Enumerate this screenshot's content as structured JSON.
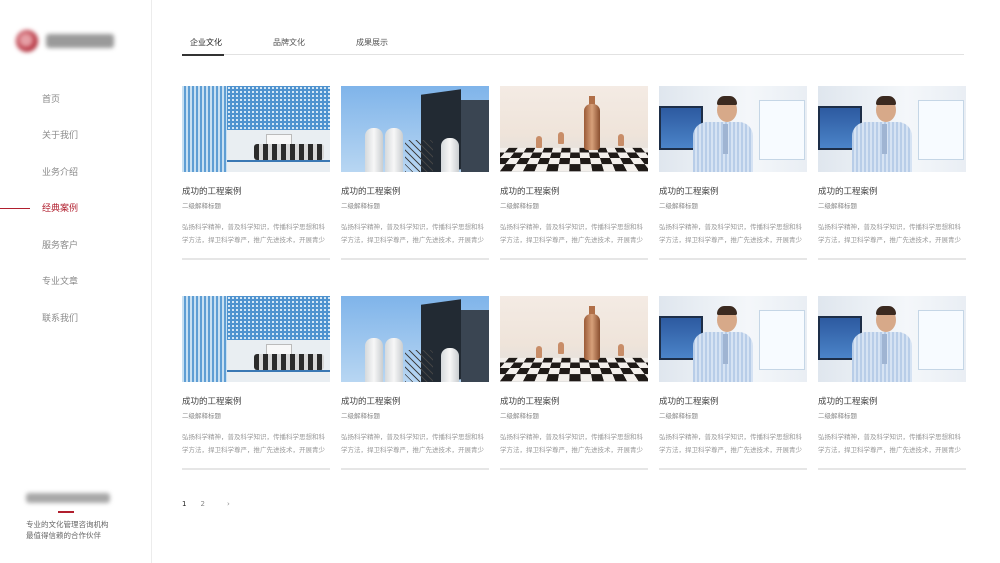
{
  "sidebar": {
    "nav": [
      "首页",
      "关于我们",
      "业务介绍",
      "经典案例",
      "服务客户",
      "专业文章",
      "联系我们"
    ],
    "active_index": 3,
    "footer": {
      "line1": "专业的文化管理咨询机构",
      "line2": "最值得信赖的合作伙伴"
    }
  },
  "tabs": [
    "企业文化",
    "品牌文化",
    "成果展示"
  ],
  "active_tab": 0,
  "cards": [
    {
      "title": "成功的工程案例",
      "subtitle": "二级解释标题",
      "desc": "弘扬科学精神，普及科学知识，传播科学思想和科学方法，捍卫科学尊严，推广先进技术，开展青少"
    },
    {
      "title": "成功的工程案例",
      "subtitle": "二级解释标题",
      "desc": "弘扬科学精神，普及科学知识，传播科学思想和科学方法，捍卫科学尊严，推广先进技术，开展青少"
    },
    {
      "title": "成功的工程案例",
      "subtitle": "二级解释标题",
      "desc": "弘扬科学精神，普及科学知识，传播科学思想和科学方法，捍卫科学尊严，推广先进技术，开展青少"
    },
    {
      "title": "成功的工程案例",
      "subtitle": "二级解释标题",
      "desc": "弘扬科学精神，普及科学知识，传播科学思想和科学方法，捍卫科学尊严，推广先进技术，开展青少"
    },
    {
      "title": "成功的工程案例",
      "subtitle": "二级解释标题",
      "desc": "弘扬科学精神，普及科学知识，传播科学思想和科学方法，捍卫科学尊严，推广先进技术，开展青少"
    },
    {
      "title": "成功的工程案例",
      "subtitle": "二级解释标题",
      "desc": "弘扬科学精神，普及科学知识，传播科学思想和科学方法，捍卫科学尊严，推广先进技术，开展青少"
    },
    {
      "title": "成功的工程案例",
      "subtitle": "二级解释标题",
      "desc": "弘扬科学精神，普及科学知识，传播科学思想和科学方法，捍卫科学尊严，推广先进技术，开展青少"
    },
    {
      "title": "成功的工程案例",
      "subtitle": "二级解释标题",
      "desc": "弘扬科学精神，普及科学知识，传播科学思想和科学方法，捍卫科学尊严，推广先进技术，开展青少"
    },
    {
      "title": "成功的工程案例",
      "subtitle": "二级解释标题",
      "desc": "弘扬科学精神，普及科学知识，传播科学思想和科学方法，捍卫科学尊严，推广先进技术，开展青少"
    },
    {
      "title": "成功的工程案例",
      "subtitle": "二级解释标题",
      "desc": "弘扬科学精神，普及科学知识，传播科学思想和科学方法，捍卫科学尊严，推广先进技术，开展青少"
    }
  ],
  "pagination": {
    "pages": [
      "1",
      "2"
    ],
    "current": "1",
    "next": "›"
  },
  "colors": {
    "accent": "#b11f2e"
  }
}
